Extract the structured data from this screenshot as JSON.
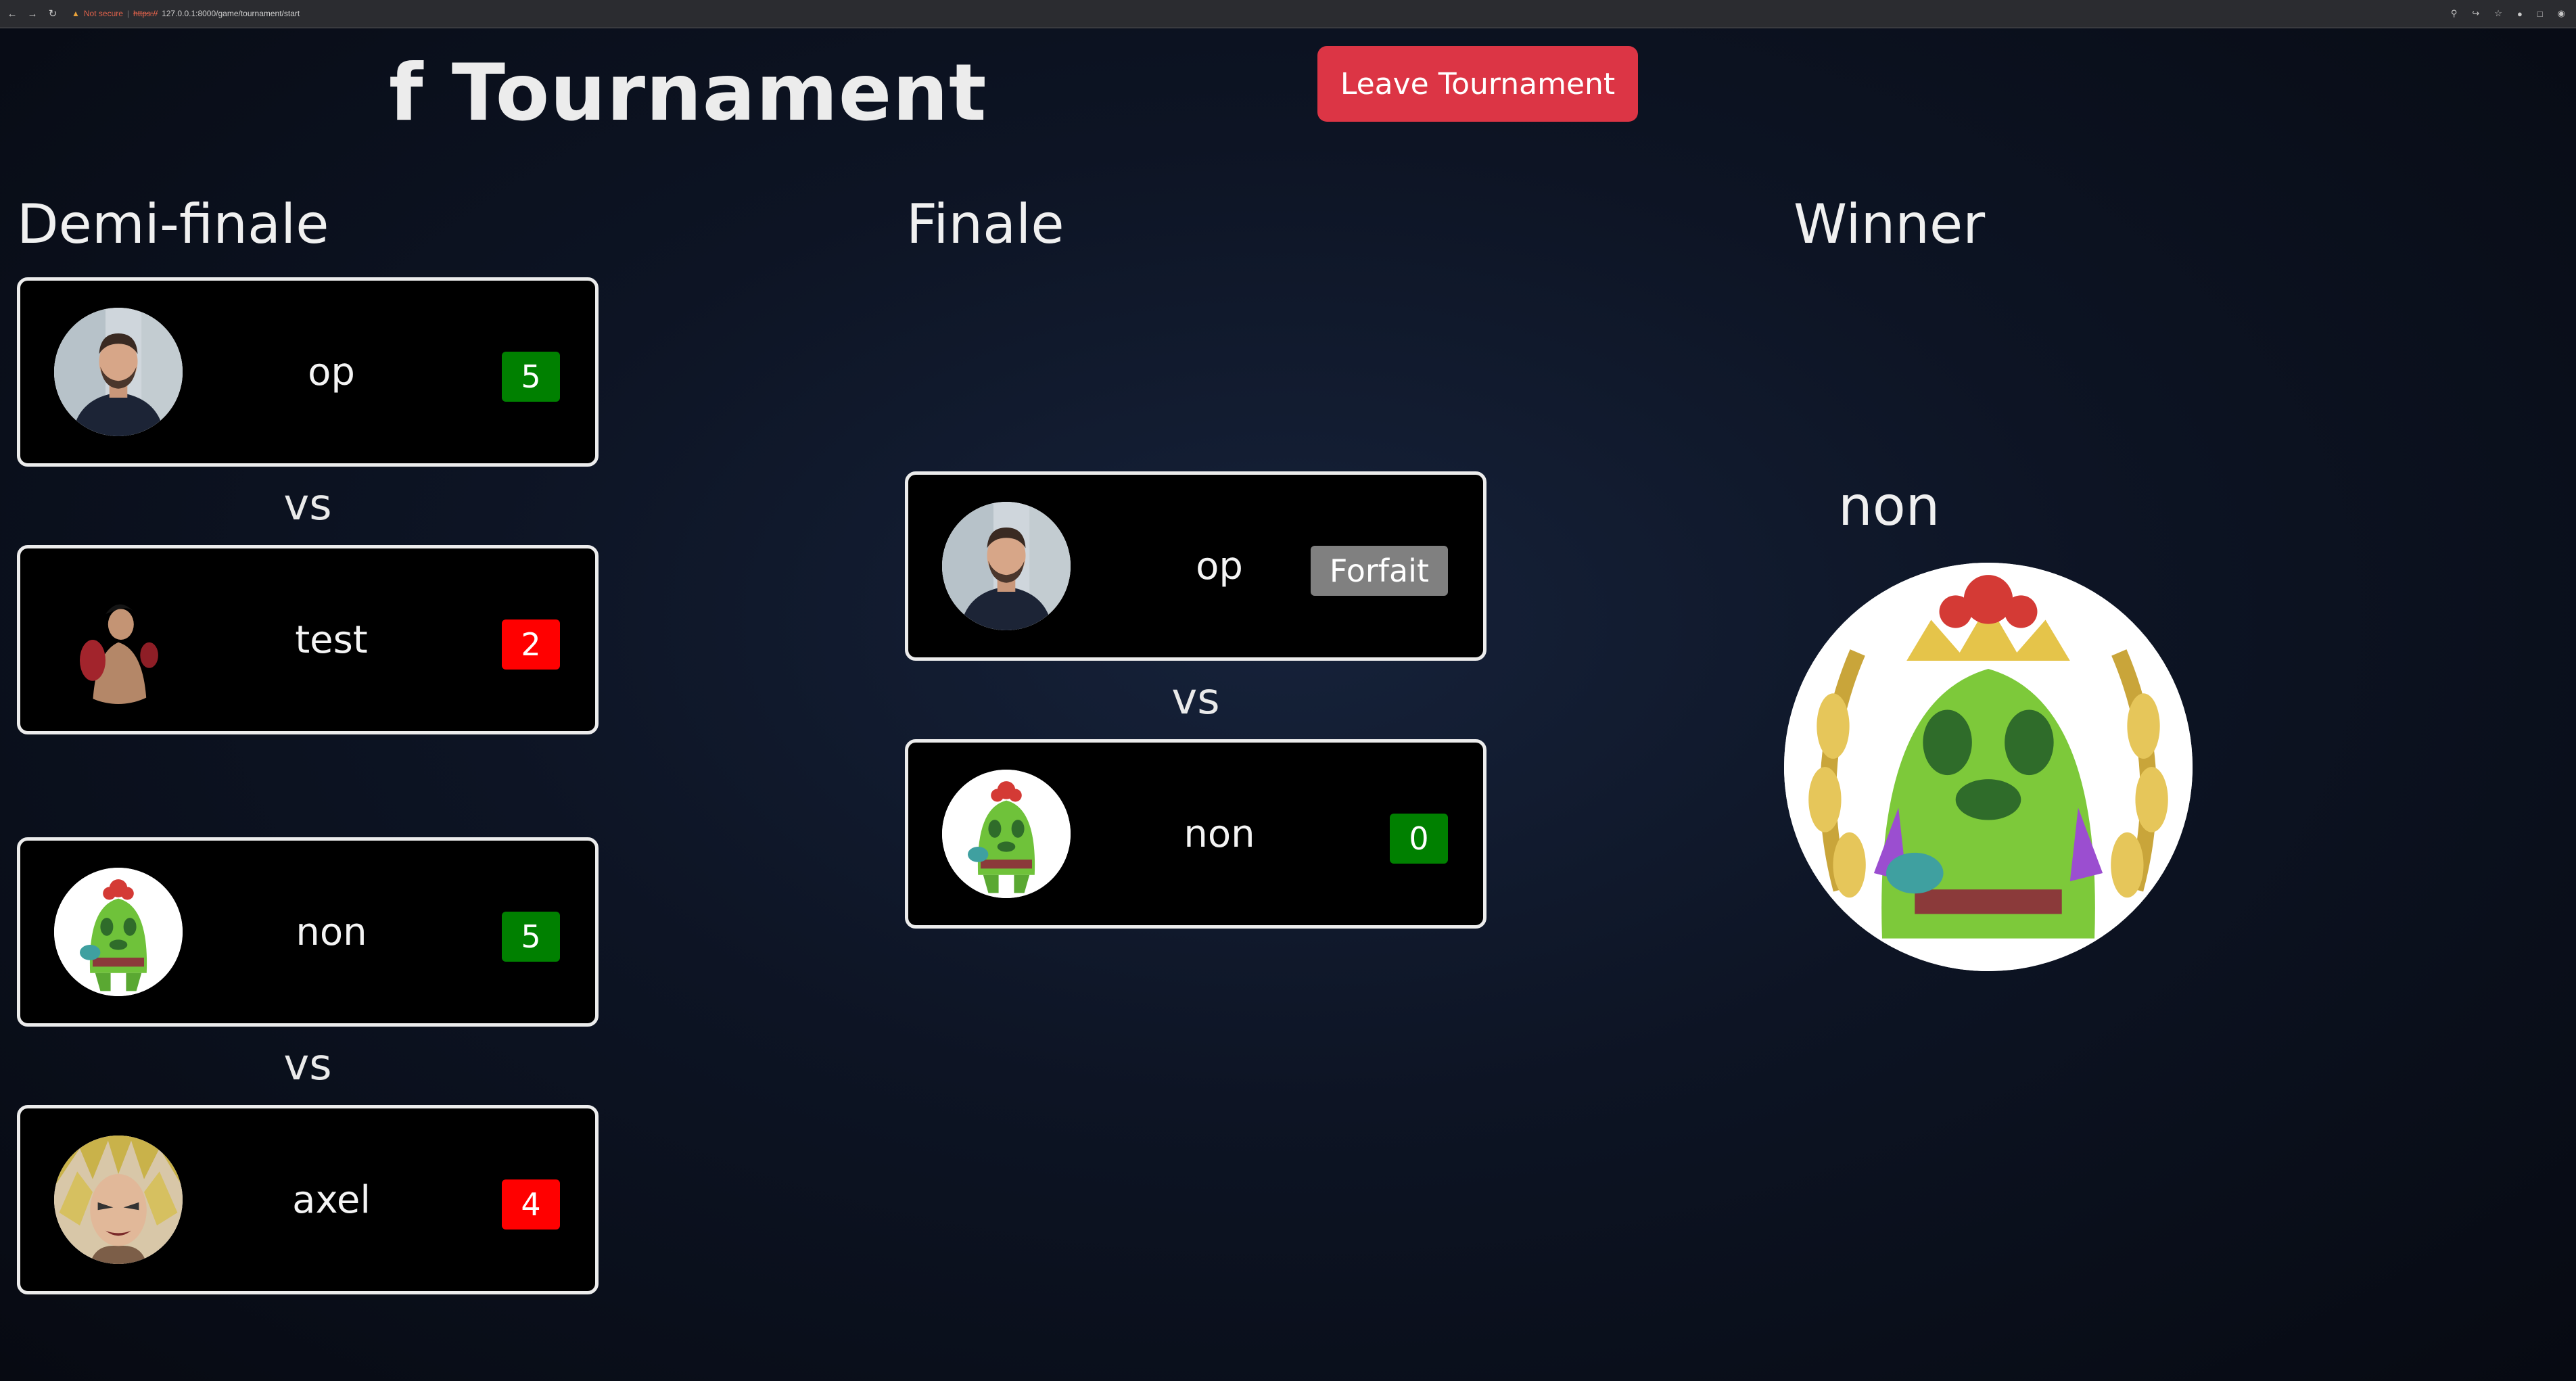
{
  "browser": {
    "security_label": "Not secure",
    "url_scheme": "https://",
    "url_rest": "127.0.0.1:8000/game/tournament/start"
  },
  "page": {
    "title": "f Tournament",
    "leave_button": "Leave Tournament"
  },
  "columns": {
    "semifinal": "Demi-finale",
    "final": "Finale",
    "winner": "Winner"
  },
  "vs_label": "vs",
  "semifinals": [
    {
      "player1": {
        "name": "op",
        "score": "5",
        "score_color": "#008000",
        "avatar": "man-portrait"
      },
      "player2": {
        "name": "test",
        "score": "2",
        "score_color": "#ff0000",
        "avatar": "fighter"
      }
    },
    {
      "player1": {
        "name": "non",
        "score": "5",
        "score_color": "#008000",
        "avatar": "cactus"
      },
      "player2": {
        "name": "axel",
        "score": "4",
        "score_color": "#ff0000",
        "avatar": "anime-hero"
      }
    }
  ],
  "final": {
    "player1": {
      "name": "op",
      "score": "Forfait",
      "score_color": "#808080",
      "avatar": "man-portrait"
    },
    "player2": {
      "name": "non",
      "score": "0",
      "score_color": "#008000",
      "avatar": "cactus"
    }
  },
  "winner": {
    "name": "non",
    "avatar": "crowned-cactus"
  }
}
